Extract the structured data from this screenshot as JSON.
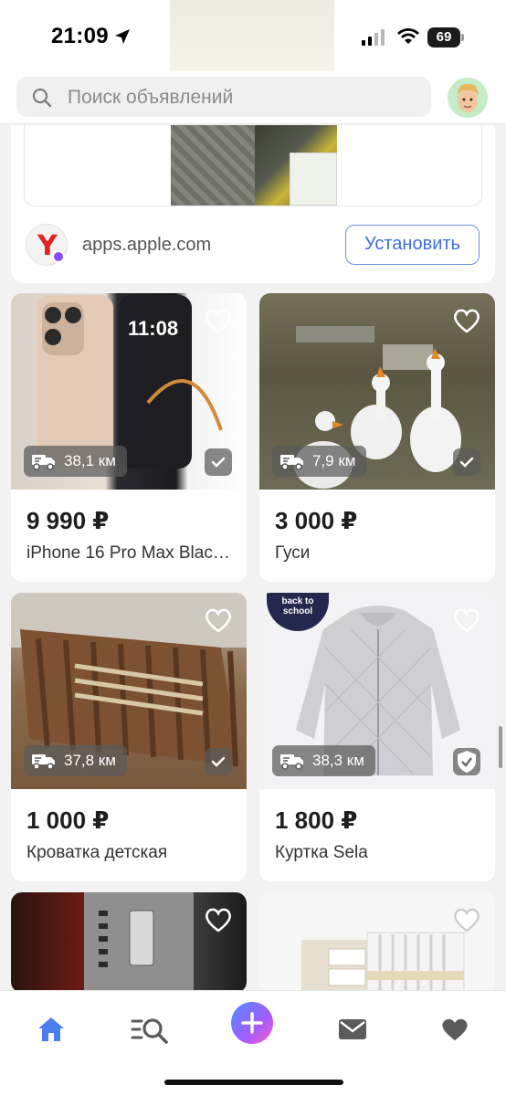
{
  "status_bar": {
    "time": "21:09",
    "battery": "69"
  },
  "header": {
    "search_placeholder": "Поиск объявлений"
  },
  "ad": {
    "domain": "apps.apple.com",
    "install_label": "Установить"
  },
  "listings": [
    {
      "distance": "38,1 км",
      "price": "9 990 ₽",
      "title": "iPhone 16 Pro Max Black Titanium"
    },
    {
      "distance": "7,9 км",
      "price": "3 000 ₽",
      "title": "Гуси"
    },
    {
      "distance": "37,8 км",
      "price": "1 000 ₽",
      "title": "Кроватка детская"
    },
    {
      "distance": "38,3 км",
      "price": "1 800 ₽",
      "title": "Куртка Sela",
      "promo_badge": "back to school"
    }
  ],
  "tabbar": {
    "items": [
      "home-icon",
      "search-list-icon",
      "add-icon",
      "mail-icon",
      "heart-icon"
    ]
  },
  "colors": {
    "accent": "#3f6ed8",
    "tab_active": "#4a7ef0",
    "tab_inactive": "#5b5b5b"
  }
}
